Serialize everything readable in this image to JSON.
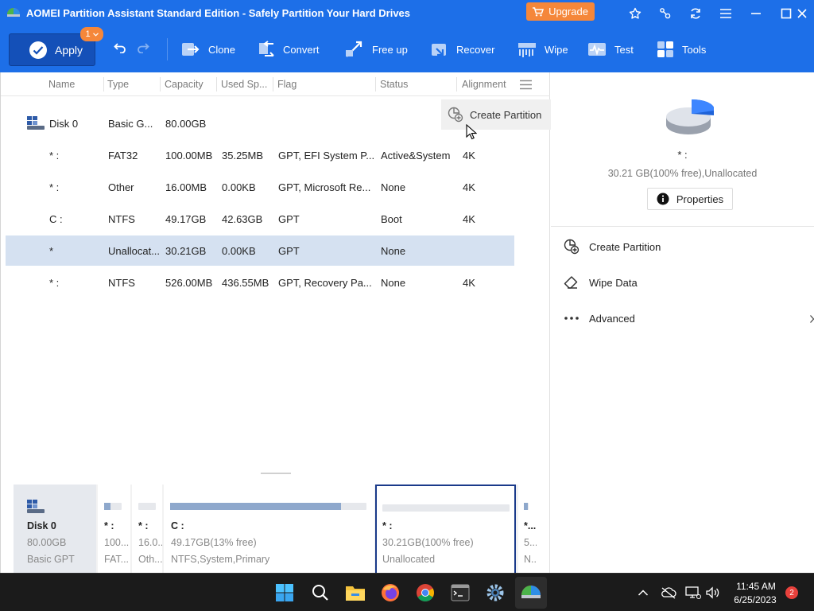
{
  "window": {
    "title": "AOMEI Partition Assistant Standard Edition - Safely Partition Your Hard Drives",
    "upgrade_label": "Upgrade",
    "title_icons": [
      "star-icon",
      "feedback-icon",
      "refresh-icon",
      "menu-icon",
      "minimize-icon",
      "maximize-icon",
      "close-icon"
    ]
  },
  "toolbar": {
    "apply_label": "Apply",
    "pending_count": "1",
    "tools": [
      {
        "label": "Clone",
        "icon": "clone-icon"
      },
      {
        "label": "Convert",
        "icon": "convert-icon"
      },
      {
        "label": "Free up",
        "icon": "free-up-icon"
      },
      {
        "label": "Recover",
        "icon": "recover-icon"
      },
      {
        "label": "Wipe",
        "icon": "wipe-icon"
      },
      {
        "label": "Test",
        "icon": "test-icon"
      },
      {
        "label": "Tools",
        "icon": "tools-icon"
      }
    ]
  },
  "table": {
    "headers": [
      "Name",
      "Type",
      "Capacity",
      "Used Sp...",
      "Flag",
      "Status",
      "Alignment"
    ],
    "disk_row": {
      "name": "Disk 0",
      "type": "Basic G...",
      "capacity": "80.00GB"
    },
    "rows": [
      {
        "name": "* :",
        "type": "FAT32",
        "capacity": "100.00MB",
        "used": "35.25MB",
        "flag": "GPT, EFI System P...",
        "status": "Active&System",
        "alignment": "4K"
      },
      {
        "name": "* :",
        "type": "Other",
        "capacity": "16.00MB",
        "used": "0.00KB",
        "flag": "GPT, Microsoft Re...",
        "status": "None",
        "alignment": "4K"
      },
      {
        "name": "C :",
        "type": "NTFS",
        "capacity": "49.17GB",
        "used": "42.63GB",
        "flag": "GPT",
        "status": "Boot",
        "alignment": "4K"
      },
      {
        "name": "*",
        "type": "Unallocat...",
        "capacity": "30.21GB",
        "used": "0.00KB",
        "flag": "GPT",
        "status": "None",
        "alignment": ""
      },
      {
        "name": "* :",
        "type": "NTFS",
        "capacity": "526.00MB",
        "used": "436.55MB",
        "flag": "GPT, Recovery Pa...",
        "status": "None",
        "alignment": "4K"
      }
    ],
    "selected_row": 3
  },
  "context_menu": {
    "label": "Create Partition"
  },
  "details": {
    "name": "* :",
    "info": "30.21 GB(100% free),Unallocated",
    "properties_label": "Properties",
    "operations": [
      {
        "label": "Create Partition",
        "icon": "create-partition-icon"
      },
      {
        "label": "Wipe Data",
        "icon": "eraser-icon"
      },
      {
        "label": "Advanced",
        "icon": "more-icon"
      }
    ]
  },
  "disk_map": {
    "disk": {
      "name": "Disk 0",
      "size": "80.00GB",
      "type": "Basic GPT"
    },
    "partitions": [
      {
        "name": "* :",
        "line2": "100....",
        "line3": "FAT...",
        "used_fraction": 0.35,
        "selected": false
      },
      {
        "name": "* :",
        "line2": "16.0...",
        "line3": "Oth...",
        "used_fraction": 0,
        "selected": false
      },
      {
        "name": "C :",
        "line2": "49.17GB(13% free)",
        "line3": "NTFS,System,Primary",
        "used_fraction": 0.87,
        "selected": false
      },
      {
        "name": "* :",
        "line2": "30.21GB(100% free)",
        "line3": "Unallocated",
        "used_fraction": 0,
        "selected": true
      },
      {
        "name": "*...",
        "line2": "5...",
        "line3": "N...",
        "used_fraction": 0.83,
        "selected": false
      }
    ]
  },
  "taskbar": {
    "apps": [
      "start-icon",
      "search-icon",
      "file-explorer-icon",
      "firefox-icon",
      "chrome-icon",
      "terminal-icon",
      "settings-icon",
      "aomei-icon"
    ],
    "tray": [
      "chevron-up-icon",
      "cloud-offline-icon",
      "network-icon",
      "volume-icon"
    ],
    "time": "11:45 AM",
    "date": "6/25/2023",
    "notifications": "2"
  },
  "colors": {
    "accent": "#1d6fe8",
    "apply_button": "#1450b8",
    "upgrade": "#f5873a",
    "selected_row": "#d5e1f1",
    "used_bar": "#8ea8cc"
  }
}
